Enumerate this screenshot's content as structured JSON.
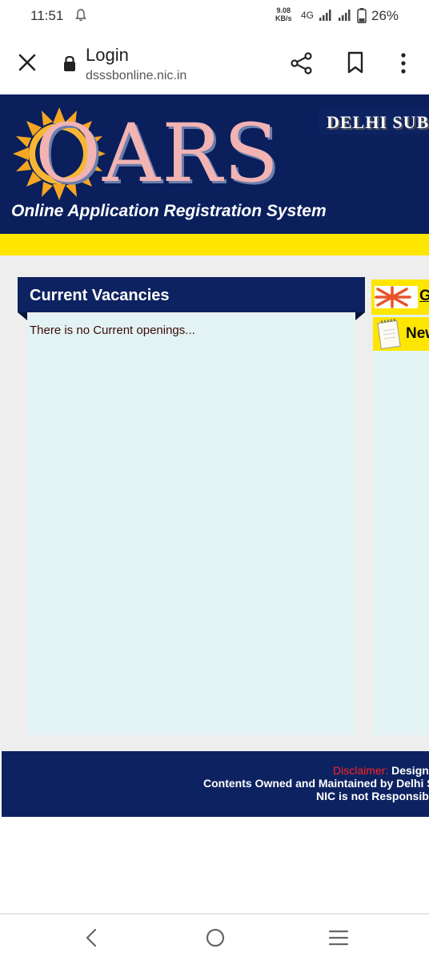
{
  "status_bar": {
    "time": "11:51",
    "speed_value": "9.08",
    "speed_unit": "KB/s",
    "network": "4G",
    "battery": "26%"
  },
  "browser": {
    "page_title": "Login",
    "url": "dsssbonline.nic.in"
  },
  "header": {
    "logo": "OARS",
    "subtitle": "Online Application Registration System",
    "banner_text": "DELHI SUBO",
    "colors": {
      "navy": "#0a1f5c",
      "yellow": "#ffe600",
      "logo_pink": "#f2b3b3"
    }
  },
  "vacancies": {
    "title": "Current Vacancies",
    "empty_message": "There is no Current openings..."
  },
  "side": {
    "link_g": "G",
    "link_new": "New"
  },
  "footer": {
    "disclaimer_label": "Disclaimer:",
    "disclaimer_text": " Designe",
    "line2": "Contents Owned and Maintained by Delhi Sub",
    "line3": "NIC is not Responsible"
  }
}
